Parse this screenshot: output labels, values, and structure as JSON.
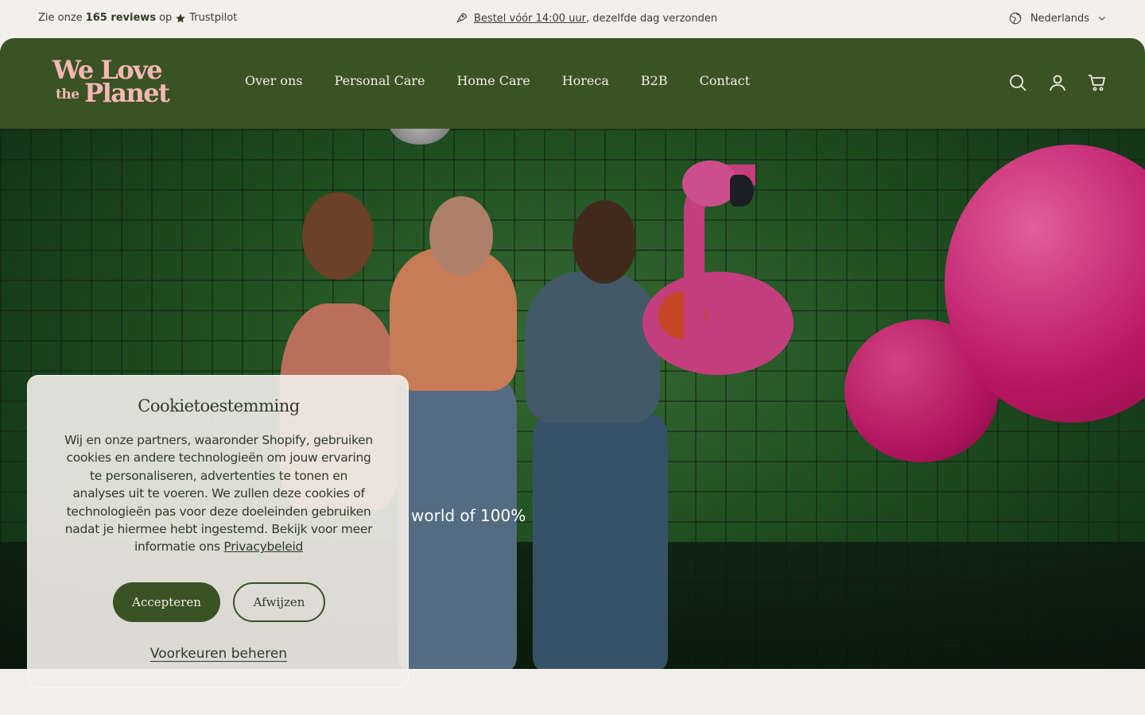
{
  "announcement": {
    "reviews_prefix": "Zie onze",
    "reviews_count": "165 reviews",
    "reviews_mid": "op",
    "reviews_brand": "Trustpilot",
    "shipping_link": "Bestel vóór 14:00 uur",
    "shipping_rest": ", dezelfde dag verzonden",
    "language": "Nederlands"
  },
  "logo": {
    "line1": "We Love",
    "line2_small": "the",
    "line2_big": "Planet"
  },
  "nav": {
    "items": [
      "Over ons",
      "Personal Care",
      "Home Care",
      "Horeca",
      "B2B",
      "Contact"
    ]
  },
  "header_icons": [
    "search-icon",
    "account-icon",
    "cart-icon"
  ],
  "hero": {
    "text": "world of 100%"
  },
  "cookie": {
    "title": "Cookietoestemming",
    "body": "Wij en onze partners, waaronder Shopify, gebruiken cookies en andere technologieën om jouw ervaring te personaliseren, advertenties te tonen en analyses uit te voeren. We zullen deze cookies of technologieën pas voor deze doeleinden gebruiken nadat je hiermee hebt ingestemd. Bekijk voor meer informatie ons",
    "privacy_link": "Privacybeleid",
    "accept": "Accepteren",
    "decline": "Afwijzen",
    "manage": "Voorkeuren beheren"
  },
  "colors": {
    "brand_green": "#3b5224",
    "logo_pink": "#f4b8b4",
    "background": "#f3efeb"
  }
}
